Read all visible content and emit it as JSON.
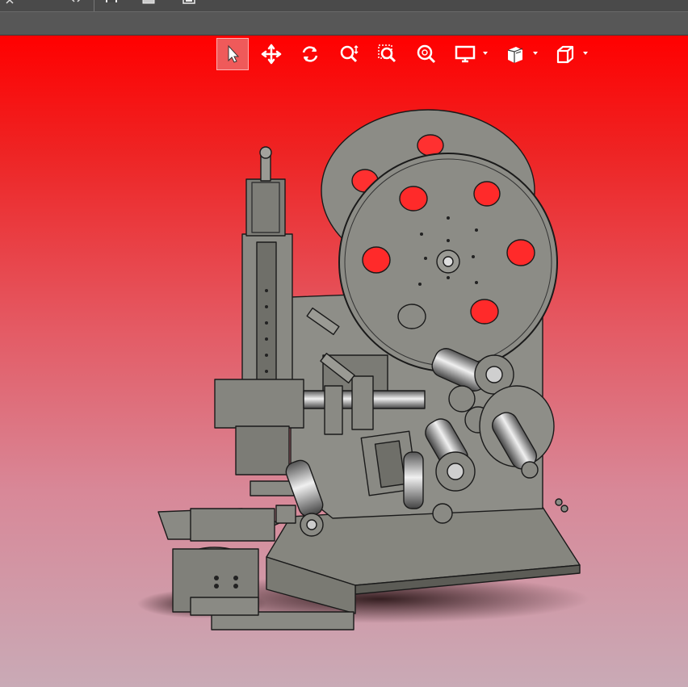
{
  "window": {
    "toolbar_icons": [
      "close-icon",
      "expand-icon",
      "save-icon",
      "print-icon",
      "copy-icon",
      "pin-icon"
    ]
  },
  "view_toolbar": {
    "tools": [
      {
        "id": "select",
        "icon": "pointer-arrow-icon",
        "active": true
      },
      {
        "id": "pan",
        "icon": "move-arrows-icon",
        "active": false
      },
      {
        "id": "rotate",
        "icon": "rotate-icon",
        "active": false
      },
      {
        "id": "zoom-dynamic",
        "icon": "zoom-dynamic-icon",
        "active": false
      },
      {
        "id": "zoom-window",
        "icon": "zoom-window-icon",
        "active": false
      },
      {
        "id": "zoom-fit",
        "icon": "zoom-fit-icon",
        "active": false
      },
      {
        "id": "display",
        "icon": "monitor-icon",
        "active": false,
        "dropdown": true
      },
      {
        "id": "section",
        "icon": "section-cube-icon",
        "active": false,
        "dropdown": true
      },
      {
        "id": "view-orient",
        "icon": "view-cube-icon",
        "active": false,
        "dropdown": true
      }
    ]
  },
  "colors": {
    "viewport_top": "#ff0000",
    "viewport_bottom": "#c9aab6",
    "part_fill": "#8a8a84",
    "part_edge": "#1a1a1a",
    "toolbar_bg": "#575757"
  },
  "model": {
    "name": "labeling-machine-assembly"
  }
}
